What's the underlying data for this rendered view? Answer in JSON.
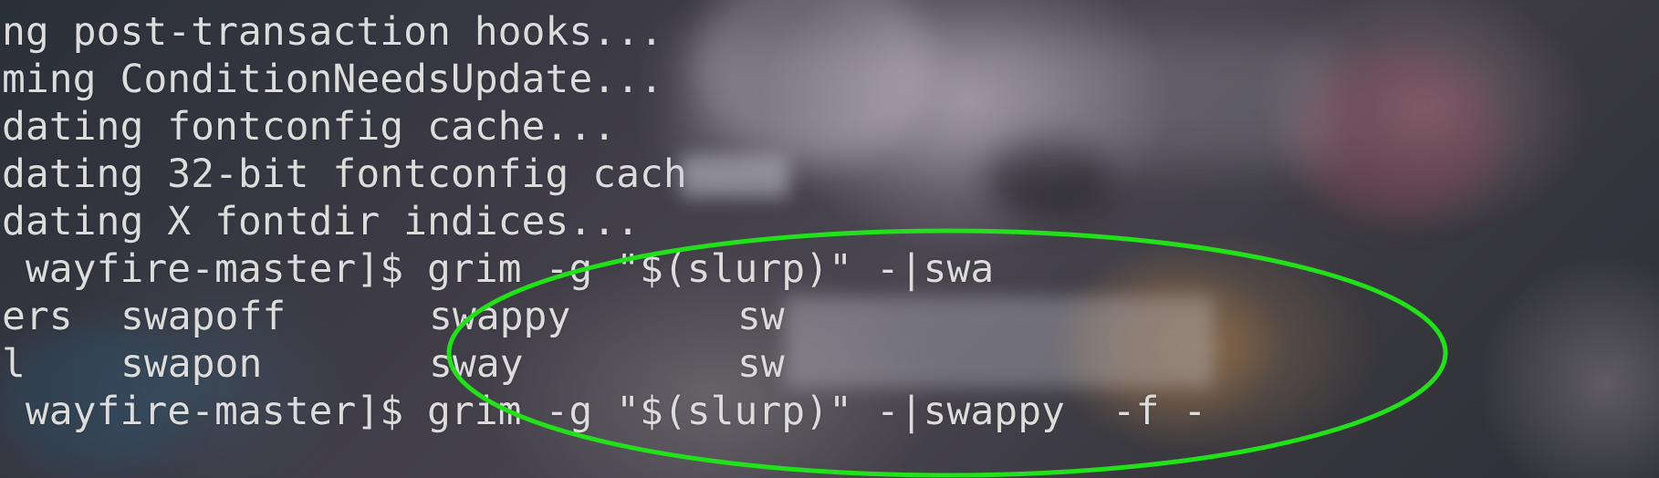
{
  "terminal": {
    "lines": [
      "ng post-transaction hooks...",
      "ming ConditionNeedsUpdate...",
      "dating fontconfig cache...",
      "dating 32-bit fontconfig cach",
      "dating X fontdir indices...",
      " wayfire-master]$ grim -g \"$(slurp)\" -|swa"
    ],
    "completions": [
      [
        "ers",
        "swapoff",
        "swappy",
        "sw"
      ],
      [
        "l",
        "swapon",
        "sway",
        "sw"
      ]
    ],
    "current_command": " wayfire-master]$ grim -g \"$(slurp)\" -|swappy  -f -"
  },
  "colors": {
    "text": "#dcdcdc",
    "annotation_ellipse": "#22e01a"
  }
}
